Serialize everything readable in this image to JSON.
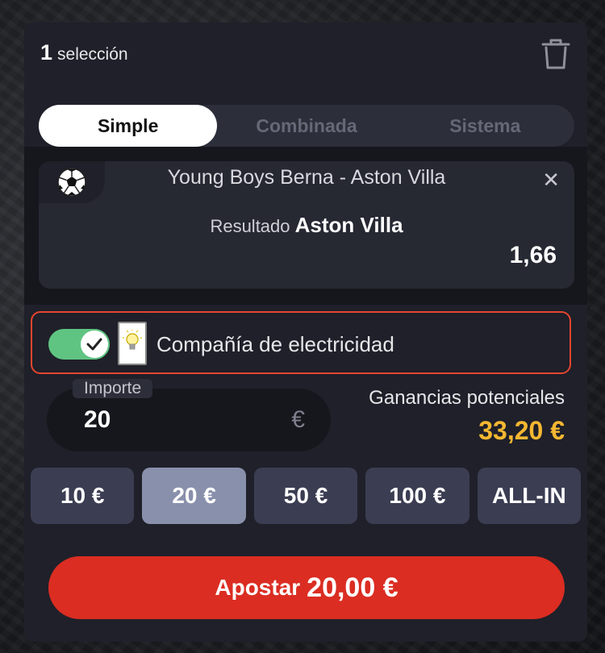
{
  "header": {
    "count": "1",
    "label": "selección"
  },
  "tabs": [
    {
      "label": "Simple",
      "active": true
    },
    {
      "label": "Combinada",
      "active": false
    },
    {
      "label": "Sistema",
      "active": false
    }
  ],
  "selection": {
    "sport_icon": "soccer-ball-icon",
    "match": "Young Boys Berna - Aston Villa",
    "market": "Resultado",
    "pick": "Aston Villa",
    "odds": "1,66"
  },
  "boost": {
    "enabled": true,
    "label": "Compañía de electricidad",
    "accent": "#e5452f",
    "toggle_color": "#5fc482"
  },
  "stake": {
    "label": "Importe",
    "value": "20",
    "currency": "€"
  },
  "gains": {
    "label": "Ganancias potenciales",
    "value": "33,20 €",
    "color": "#f5b731"
  },
  "quick_amounts": [
    {
      "label": "10 €",
      "active": false
    },
    {
      "label": "20 €",
      "active": true
    },
    {
      "label": "50 €",
      "active": false
    },
    {
      "label": "100 €",
      "active": false
    },
    {
      "label": "ALL-IN",
      "active": false
    }
  ],
  "bet_button": {
    "label": "Apostar",
    "amount": "20,00 €",
    "color": "#db2d22"
  }
}
